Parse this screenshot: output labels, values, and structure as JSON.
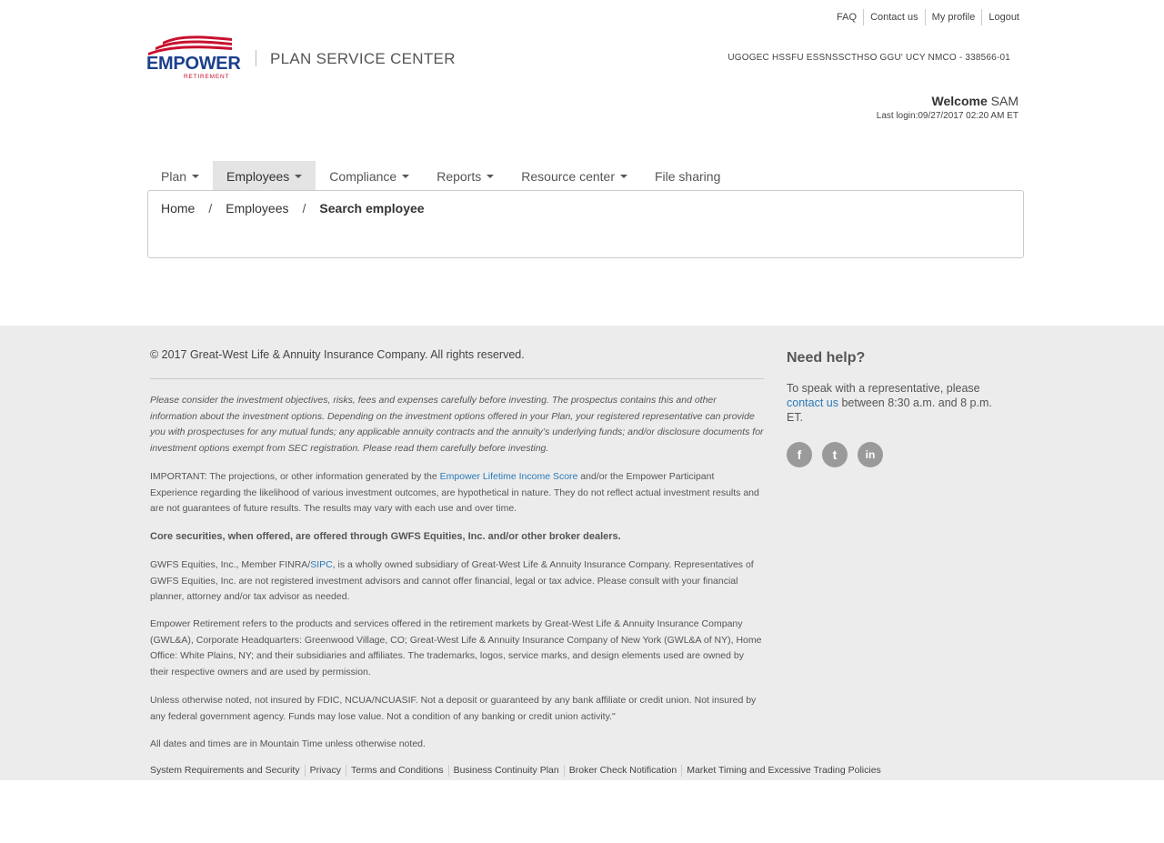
{
  "header": {
    "top_links": [
      "FAQ",
      "Contact us",
      "My profile",
      "Logout"
    ],
    "logo_brand": "EMPOWER",
    "logo_sub": "RETIREMENT",
    "app_title": "PLAN SERVICE CENTER",
    "plan_name": "UGOGEC HSSFU ESSNSSCTHSO GGU' UCY NMCO - 338566-01",
    "welcome_label": "Welcome",
    "user_name": "SAM",
    "last_login": "Last login:09/27/2017 02:20 AM ET"
  },
  "nav": {
    "items": [
      {
        "label": "Plan",
        "dropdown": true,
        "active": false
      },
      {
        "label": "Employees",
        "dropdown": true,
        "active": true
      },
      {
        "label": "Compliance",
        "dropdown": true,
        "active": false
      },
      {
        "label": "Reports",
        "dropdown": true,
        "active": false
      },
      {
        "label": "Resource center",
        "dropdown": true,
        "active": false
      },
      {
        "label": "File sharing",
        "dropdown": false,
        "active": false
      }
    ]
  },
  "breadcrumb": {
    "home": "Home",
    "section": "Employees",
    "current": "Search employee",
    "separator": "/"
  },
  "footer": {
    "copyright": "© 2017 Great-West Life & Annuity Insurance Company. All rights reserved.",
    "disclaimer_italic": "Please consider the investment objectives, risks, fees and expenses carefully before investing. The prospectus contains this and other information about the investment options. Depending on the investment options offered in your Plan, your registered representative can provide you with prospectuses for any mutual funds; any applicable annuity contracts and the annuity’s underlying funds; and/or disclosure documents for investment options exempt from SEC registration. Please read them carefully before investing.",
    "important_before": "IMPORTANT: The projections, or other information generated by the ",
    "important_link": "Empower Lifetime Income Score",
    "important_after": " and/or the Empower Participant Experience regarding the likelihood of various investment outcomes, are hypothetical in nature. They do not reflect actual investment results and are not guarantees of future results. The results may vary with each use and over time.",
    "core_securities": "Core securities, when offered, are offered through GWFS Equities, Inc. and/or other broker dealers.",
    "gwfs_before": "GWFS Equities, Inc., Member FINRA/",
    "gwfs_link": "SIPC",
    "gwfs_after": ", is a wholly owned subsidiary of Great-West Life & Annuity Insurance Company. Representatives of GWFS Equities, Inc. are not registered investment advisors and cannot offer financial, legal or tax advice. Please consult with your financial planner, attorney and/or tax advisor as needed.",
    "empower_refers": "Empower Retirement refers to the products and services offered in the retirement markets by Great-West Life & Annuity Insurance Company (GWL&A), Corporate Headquarters: Greenwood Village, CO; Great-West Life & Annuity Insurance Company of New York (GWL&A of NY), Home Office: White Plains, NY; and their subsidiaries and affiliates. The trademarks, logos, service marks, and design elements used are owned by their respective owners and are used by permission.",
    "fdic": "Unless otherwise noted, not insured by FDIC, NCUA/NCUASIF. Not a deposit or guaranteed by any bank affiliate or credit union. Not insured by any federal government agency. Funds may lose value. Not a condition of any banking or credit union activity.\"",
    "dates": "All dates and times are in Mountain Time unless otherwise noted.",
    "links": [
      "System Requirements and Security",
      "Privacy",
      "Terms and Conditions",
      "Business Continuity Plan",
      "Broker Check Notification",
      "Market Timing and Excessive Trading Policies"
    ],
    "help": {
      "title": "Need help?",
      "text_before": "To speak with a representative, please ",
      "link": "contact us",
      "text_after": "  between 8:30 a.m. and 8 p.m. ET."
    },
    "socials": [
      {
        "icon": "facebook-icon",
        "glyph": "f"
      },
      {
        "icon": "twitter-icon",
        "glyph": "t"
      },
      {
        "icon": "linkedin-icon",
        "glyph": "in"
      }
    ]
  },
  "colors": {
    "brand_blue": "#1b3f8c",
    "brand_red": "#c8102e",
    "link_blue": "#2a7ab8",
    "footer_bg": "#ececec",
    "nav_active_bg": "#e4e4e4"
  }
}
